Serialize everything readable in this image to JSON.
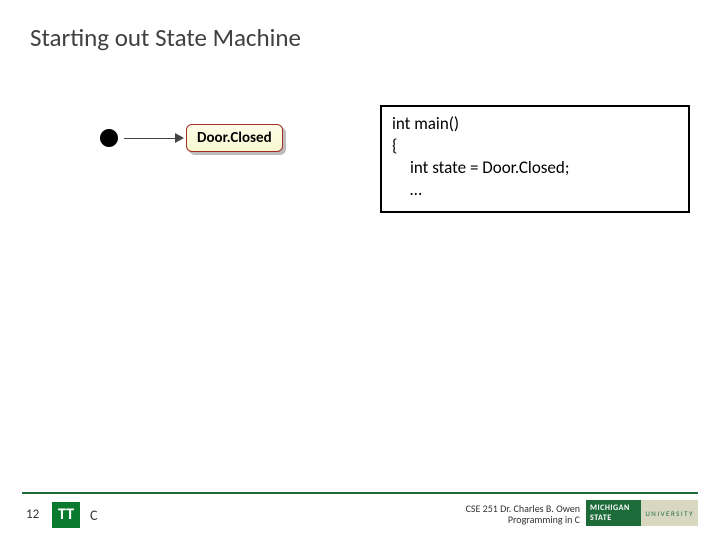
{
  "title": "Starting out State Machine",
  "diagram": {
    "state_label": "Door.Closed"
  },
  "code": {
    "line1": "int main()",
    "line2": "{",
    "line3": "int state = Door.Closed;",
    "line4": "…"
  },
  "footer": {
    "slide_number": "12",
    "badge": "TT",
    "lang": "C",
    "credit_line1": "CSE 251 Dr. Charles B. Owen",
    "credit_line2": "Programming in C",
    "logo_left": "MICHIGAN STATE",
    "logo_right": "UNIVERSITY"
  }
}
